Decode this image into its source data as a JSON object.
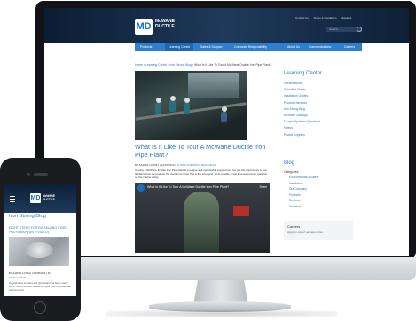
{
  "site": {
    "logo_mark": "MD",
    "logo_text": "McWANE DUCTILE",
    "utility_links": [
      "Contact Us",
      "Terms & Conditions",
      "Español"
    ],
    "search_placeholder": "Search...",
    "nav": [
      "Products",
      "Learning Center",
      "Sales & Support",
      "Corporate Responsibility",
      "About Us",
      "Communications",
      "Careers"
    ],
    "breadcrumb": [
      "Home",
      "Learning Center",
      "Iron Strong Blog",
      "What Is It Like To Tour A McWane Ductile Iron Pipe Plant?"
    ]
  },
  "article": {
    "title": "What Is It Like To Tour A McWane Ductile Iron Pipe Plant?",
    "meta_prefix": "BY AARON LOOSLI  |  12/13/2019  |",
    "meta_categories": "IN OUR COMPANY, TECHNICAL",
    "body": "Touring a McWane Ductile Iron Pipe plant is a unique and memorable experience. You get the opportunity to see firsthand how we produce the ductile iron pipe that is the strongest, most reliable, most time-tested pipe material on the market today."
  },
  "video": {
    "title": "What Is It Like To Tour A McWane Ductile Iron Pipe Plant?",
    "share_label": "Share"
  },
  "sidebar": {
    "learning_title": "Learning Center",
    "learning_links": [
      "Specifications",
      "Submittal Sheets",
      "Installation Guides",
      "Product Literature",
      "Iron Strong Blog",
      "Archived Catalogs",
      "Frequently Asked Questions",
      "Videos",
      "Pocket Engineer"
    ],
    "blog_title": "Blog",
    "categories_label": "Categories",
    "categories": [
      "Environmental & Safety",
      "Installation",
      "Our Company",
      "Products",
      "Services",
      "Technical"
    ],
    "careers_title": "Careers",
    "careers_sub": "Apply to one of our open roles"
  },
  "phone": {
    "logo_mark": "MD",
    "logo_text": "McWANE DUCTILE",
    "blog_title": "Iron Strong Blog",
    "post_title": "EIGHT STEPS FOR INSTALLING V-BIO POLYWRAP (WITH VIDEO)",
    "meta_prefix": "BY AARON LOOSLI  |  09/08/2016  |  IN",
    "meta_category": "INSTALLATION",
    "body": "Polyethylene encasement (polywrap) has been used since 1958 to protect ductile iron pipe from corrosive soil environments."
  },
  "colors": {
    "accent_blue": "#2a77c5",
    "nav_blue": "#2e7fd0",
    "header_navy": "#0b1d33"
  }
}
